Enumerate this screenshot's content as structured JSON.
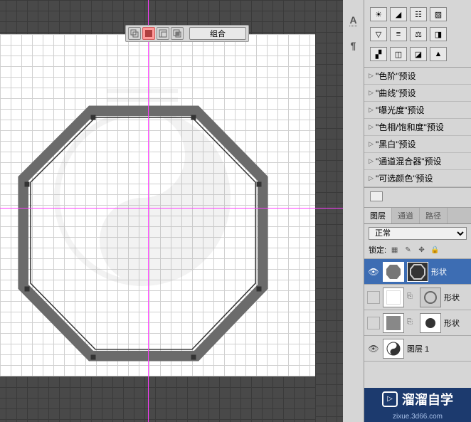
{
  "path_toolbar": {
    "btn1": "⬚",
    "btn2": "◻",
    "btn3": "◻",
    "btn4": "▣",
    "combine": "组合"
  },
  "side_icons": {
    "text": "A",
    "para": "¶"
  },
  "presets": {
    "item0": "\"色阶\"预设",
    "item1": "\"曲线\"预设",
    "item2": "\"曝光度\"预设",
    "item3": "\"色相/饱和度\"预设",
    "item4": "\"黑白\"预设",
    "item5": "\"通道混合器\"预设",
    "item6": "\"可选颜色\"预设"
  },
  "tabs": {
    "layers": "图层",
    "channels": "通道",
    "paths": "路径"
  },
  "blend": {
    "mode": "正常"
  },
  "lock": {
    "label": "锁定:"
  },
  "layers": {
    "l0name": "形状",
    "l1name": "形状",
    "l2name": "形状",
    "l3name": "图层 1"
  },
  "watermark": {
    "text": "溜溜自学",
    "url": "zixue.3d66.com"
  }
}
